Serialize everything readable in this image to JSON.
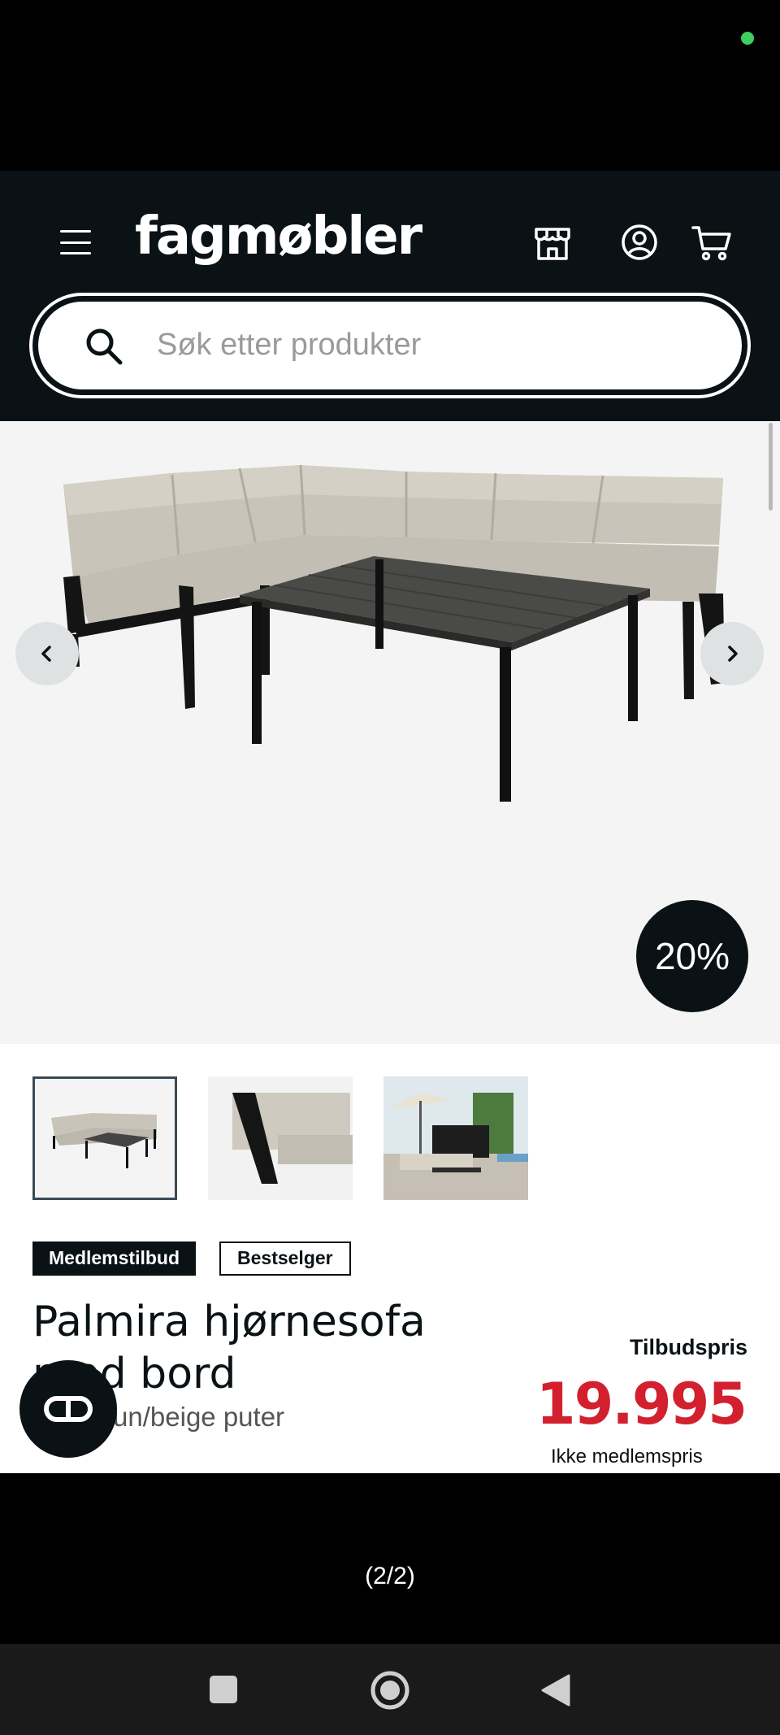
{
  "header": {
    "logo": "fagmøbler",
    "icons": [
      "menu-icon",
      "store-icon",
      "account-icon",
      "cart-icon"
    ]
  },
  "search": {
    "placeholder": "Søk etter produkter"
  },
  "gallery": {
    "discount_badge": "20%",
    "prev_icon": "chevron-left-icon",
    "next_icon": "chevron-right-icon",
    "thumbnails": [
      "sofa-table-set",
      "armrest-detail",
      "patio-scene"
    ]
  },
  "product": {
    "badges": [
      "Medlemstilbud",
      "Bestselger"
    ],
    "title": "Palmira hjørnesofa med bord",
    "subtitle": "Sort/brun/beige puter",
    "price_label": "Tilbudspris",
    "price": "19.995",
    "member_price_label": "Ikke medlemspris"
  },
  "page_indicator": "(2/2)",
  "colors": {
    "header_bg": "#0b1215",
    "price": "#d3202f",
    "status_dot": "#3ecf5e"
  }
}
